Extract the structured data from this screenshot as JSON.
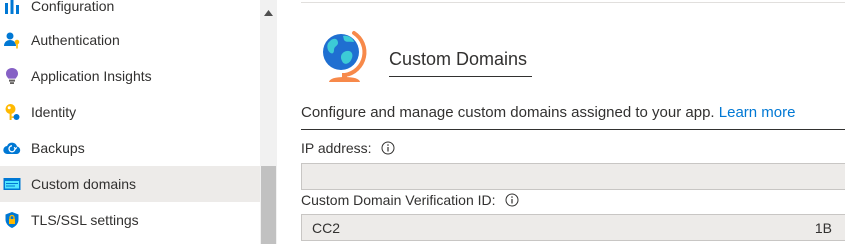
{
  "sidebar": {
    "items": [
      {
        "label": "Configuration",
        "icon": "configuration-icon",
        "active": false
      },
      {
        "label": "Authentication",
        "icon": "authentication-icon",
        "active": false
      },
      {
        "label": "Application Insights",
        "icon": "application-insights-icon",
        "active": false
      },
      {
        "label": "Identity",
        "icon": "identity-icon",
        "active": false
      },
      {
        "label": "Backups",
        "icon": "backups-icon",
        "active": false
      },
      {
        "label": "Custom domains",
        "icon": "custom-domains-icon",
        "active": true
      },
      {
        "label": "TLS/SSL settings",
        "icon": "tls-ssl-icon",
        "active": false
      }
    ]
  },
  "main": {
    "hero": {
      "title": "Custom Domains",
      "icon": "globe-icon"
    },
    "description": "Configure and manage custom domains assigned to your app.",
    "learn_more": "Learn more",
    "ip_address": {
      "label": "IP address:",
      "value": ""
    },
    "verification_id": {
      "label": "Custom Domain Verification ID:",
      "value_start": "CC2",
      "value_end": "1B"
    }
  },
  "colors": {
    "accent": "#0078d4",
    "active_item_bg": "#edebe9",
    "field_bg": "#edebe9",
    "scroll_thumb": "#c1c1c1"
  }
}
